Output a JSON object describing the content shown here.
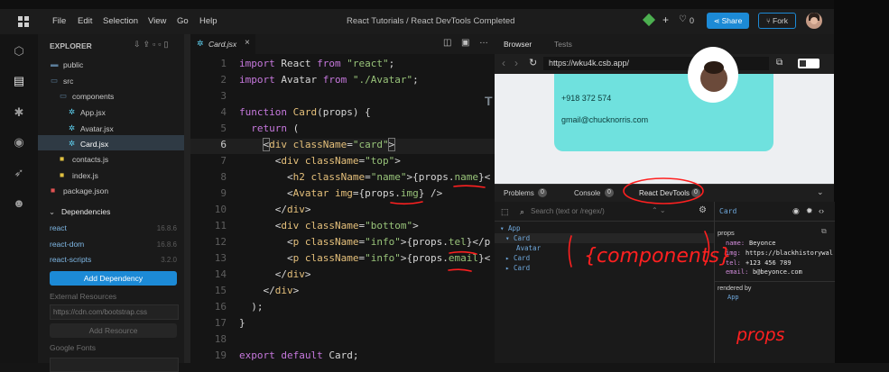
{
  "menubar": {
    "items": [
      "File",
      "Edit",
      "Selection",
      "View",
      "Go",
      "Help"
    ],
    "title": "React Tutorials / React DevTools Completed",
    "like_count": "0",
    "share_label": "Share",
    "fork_label": "Fork"
  },
  "sidebar": {
    "explorer_label": "EXPLORER",
    "files": [
      {
        "label": "public",
        "type": "folder"
      },
      {
        "label": "src",
        "type": "folder"
      },
      {
        "label": "components",
        "type": "folder"
      },
      {
        "label": "App.jsx",
        "type": "react"
      },
      {
        "label": "Avatar.jsx",
        "type": "react"
      },
      {
        "label": "Card.jsx",
        "type": "react",
        "selected": true
      },
      {
        "label": "contacts.js",
        "type": "js"
      },
      {
        "label": "index.js",
        "type": "js"
      },
      {
        "label": "package.json",
        "type": "json"
      }
    ],
    "dependencies_label": "Dependencies",
    "dependencies": [
      {
        "name": "react",
        "version": "16.8.6"
      },
      {
        "name": "react-dom",
        "version": "16.8.6"
      },
      {
        "name": "react-scripts",
        "version": "3.2.0"
      }
    ],
    "add_dependency_label": "Add Dependency",
    "external_resources_label": "External Resources",
    "resource_placeholder": "https://cdn.com/bootstrap.css",
    "add_resource_label": "Add Resource",
    "google_fonts_label": "Google Fonts"
  },
  "editor": {
    "tab_label": "Card.jsx",
    "line_numbers": [
      "1",
      "2",
      "3",
      "4",
      "5",
      "6",
      "7",
      "8",
      "9",
      "10",
      "11",
      "12",
      "13",
      "14",
      "15",
      "16",
      "17",
      "18",
      "19"
    ]
  },
  "browser": {
    "tab_browser": "Browser",
    "tab_tests": "Tests",
    "url": "https://wku4k.csb.app/",
    "phone": "+918 372 574",
    "email": "gmail@chucknorris.com"
  },
  "devtools": {
    "tab_problems": "Problems",
    "tab_console": "Console",
    "tab_react": "React DevTools",
    "problems_count": "0",
    "console_count": "0",
    "react_count": "0",
    "search_placeholder": "Search (text or /regex/)",
    "tree": [
      "App",
      "Card",
      "Avatar",
      "Card",
      "Card"
    ],
    "selected_component": "Card",
    "props_label": "props",
    "props": [
      {
        "key": "name:",
        "value": "Beyonce"
      },
      {
        "key": "img:",
        "value": "https://blackhistorywal"
      },
      {
        "key": "tel:",
        "value": "+123 456 789"
      },
      {
        "key": "email:",
        "value": "b@beyonce.com"
      }
    ],
    "rendered_by_label": "rendered by",
    "rendered_by": "App"
  },
  "annotations": {
    "components_note": "{components}",
    "props_note": "props"
  },
  "colors": {
    "accent_blue": "#1c8ad6",
    "selection": "#2f3a44",
    "red_annotation": "#ff2020",
    "card_teal": "#6fe1de"
  }
}
